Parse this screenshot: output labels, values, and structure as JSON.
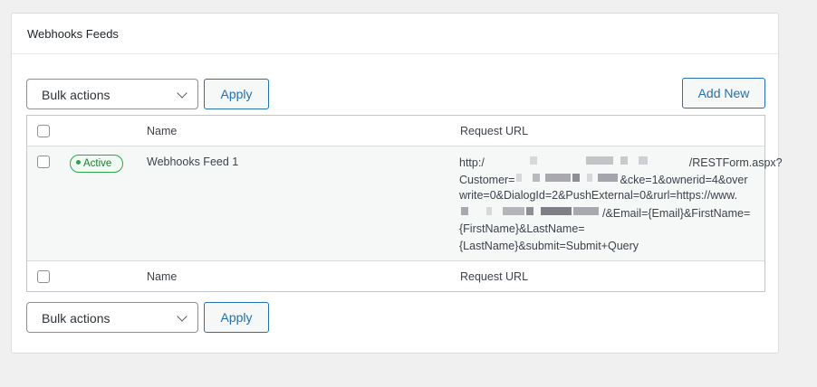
{
  "panel": {
    "title": "Webhooks Feeds"
  },
  "top_controls": {
    "bulk_select_value": "Bulk actions",
    "apply_label": "Apply",
    "add_new_label": "Add New"
  },
  "table": {
    "columns": [
      "",
      "Name",
      "Request URL"
    ],
    "rows": [
      {
        "status": "Active",
        "name": "Webhooks Feed 1",
        "request_url_lines": [
          "http:/",
          "/RESTForm.aspx?",
          "Customer=",
          "&cke=1&ownerid=4&over",
          "write=0&DialogId=2&PushExternal=0&rurl=https://www.",
          "/&Email={Email}&FirstName=",
          "{FirstName}&LastName=",
          "{LastName}&submit=Submit+Query"
        ]
      }
    ],
    "footer_columns": [
      "",
      "Name",
      "Request URL"
    ]
  },
  "bottom_controls": {
    "bulk_select_value": "Bulk actions",
    "apply_label": "Apply"
  },
  "colors": {
    "accent": "#2271b1",
    "active_green": "#2ea44f",
    "row_highlight": "#f6f7f7",
    "page_bg": "#f0f0f1"
  }
}
